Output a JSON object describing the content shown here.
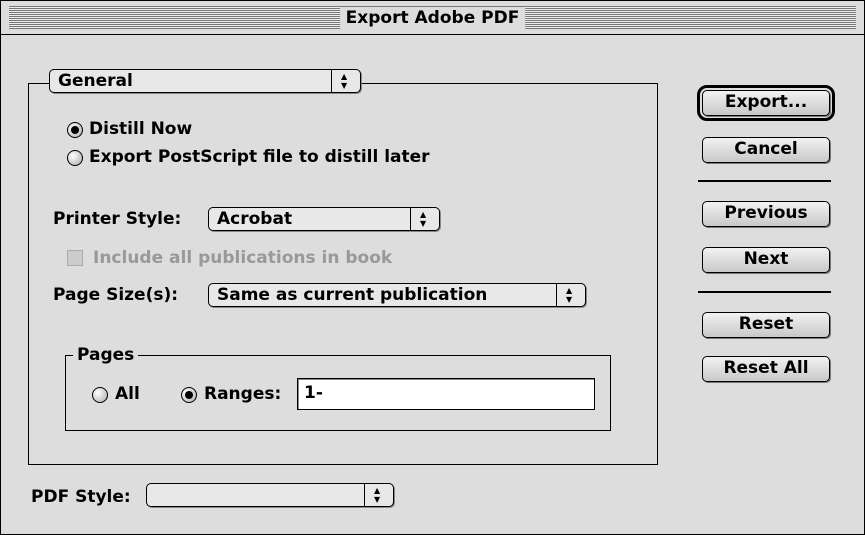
{
  "window": {
    "title": "Export Adobe PDF"
  },
  "panel": {
    "selected": "General"
  },
  "distill": {
    "option_now": "Distill Now",
    "option_later": "Export PostScript file to distill later",
    "selected": "Distill Now"
  },
  "printer_style": {
    "label": "Printer Style:",
    "value": "Acrobat"
  },
  "include_publications": {
    "label": "Include all publications in book",
    "checked": false,
    "enabled": false
  },
  "page_sizes": {
    "label": "Page Size(s):",
    "value": "Same as current publication"
  },
  "pages": {
    "legend": "Pages",
    "all_label": "All",
    "ranges_label": "Ranges:",
    "ranges_value": "1-",
    "selected": "Ranges"
  },
  "pdf_style": {
    "label": "PDF Style:",
    "value": ""
  },
  "buttons": {
    "export": "Export...",
    "cancel": "Cancel",
    "previous": "Previous",
    "next": "Next",
    "reset": "Reset",
    "reset_all": "Reset All"
  }
}
